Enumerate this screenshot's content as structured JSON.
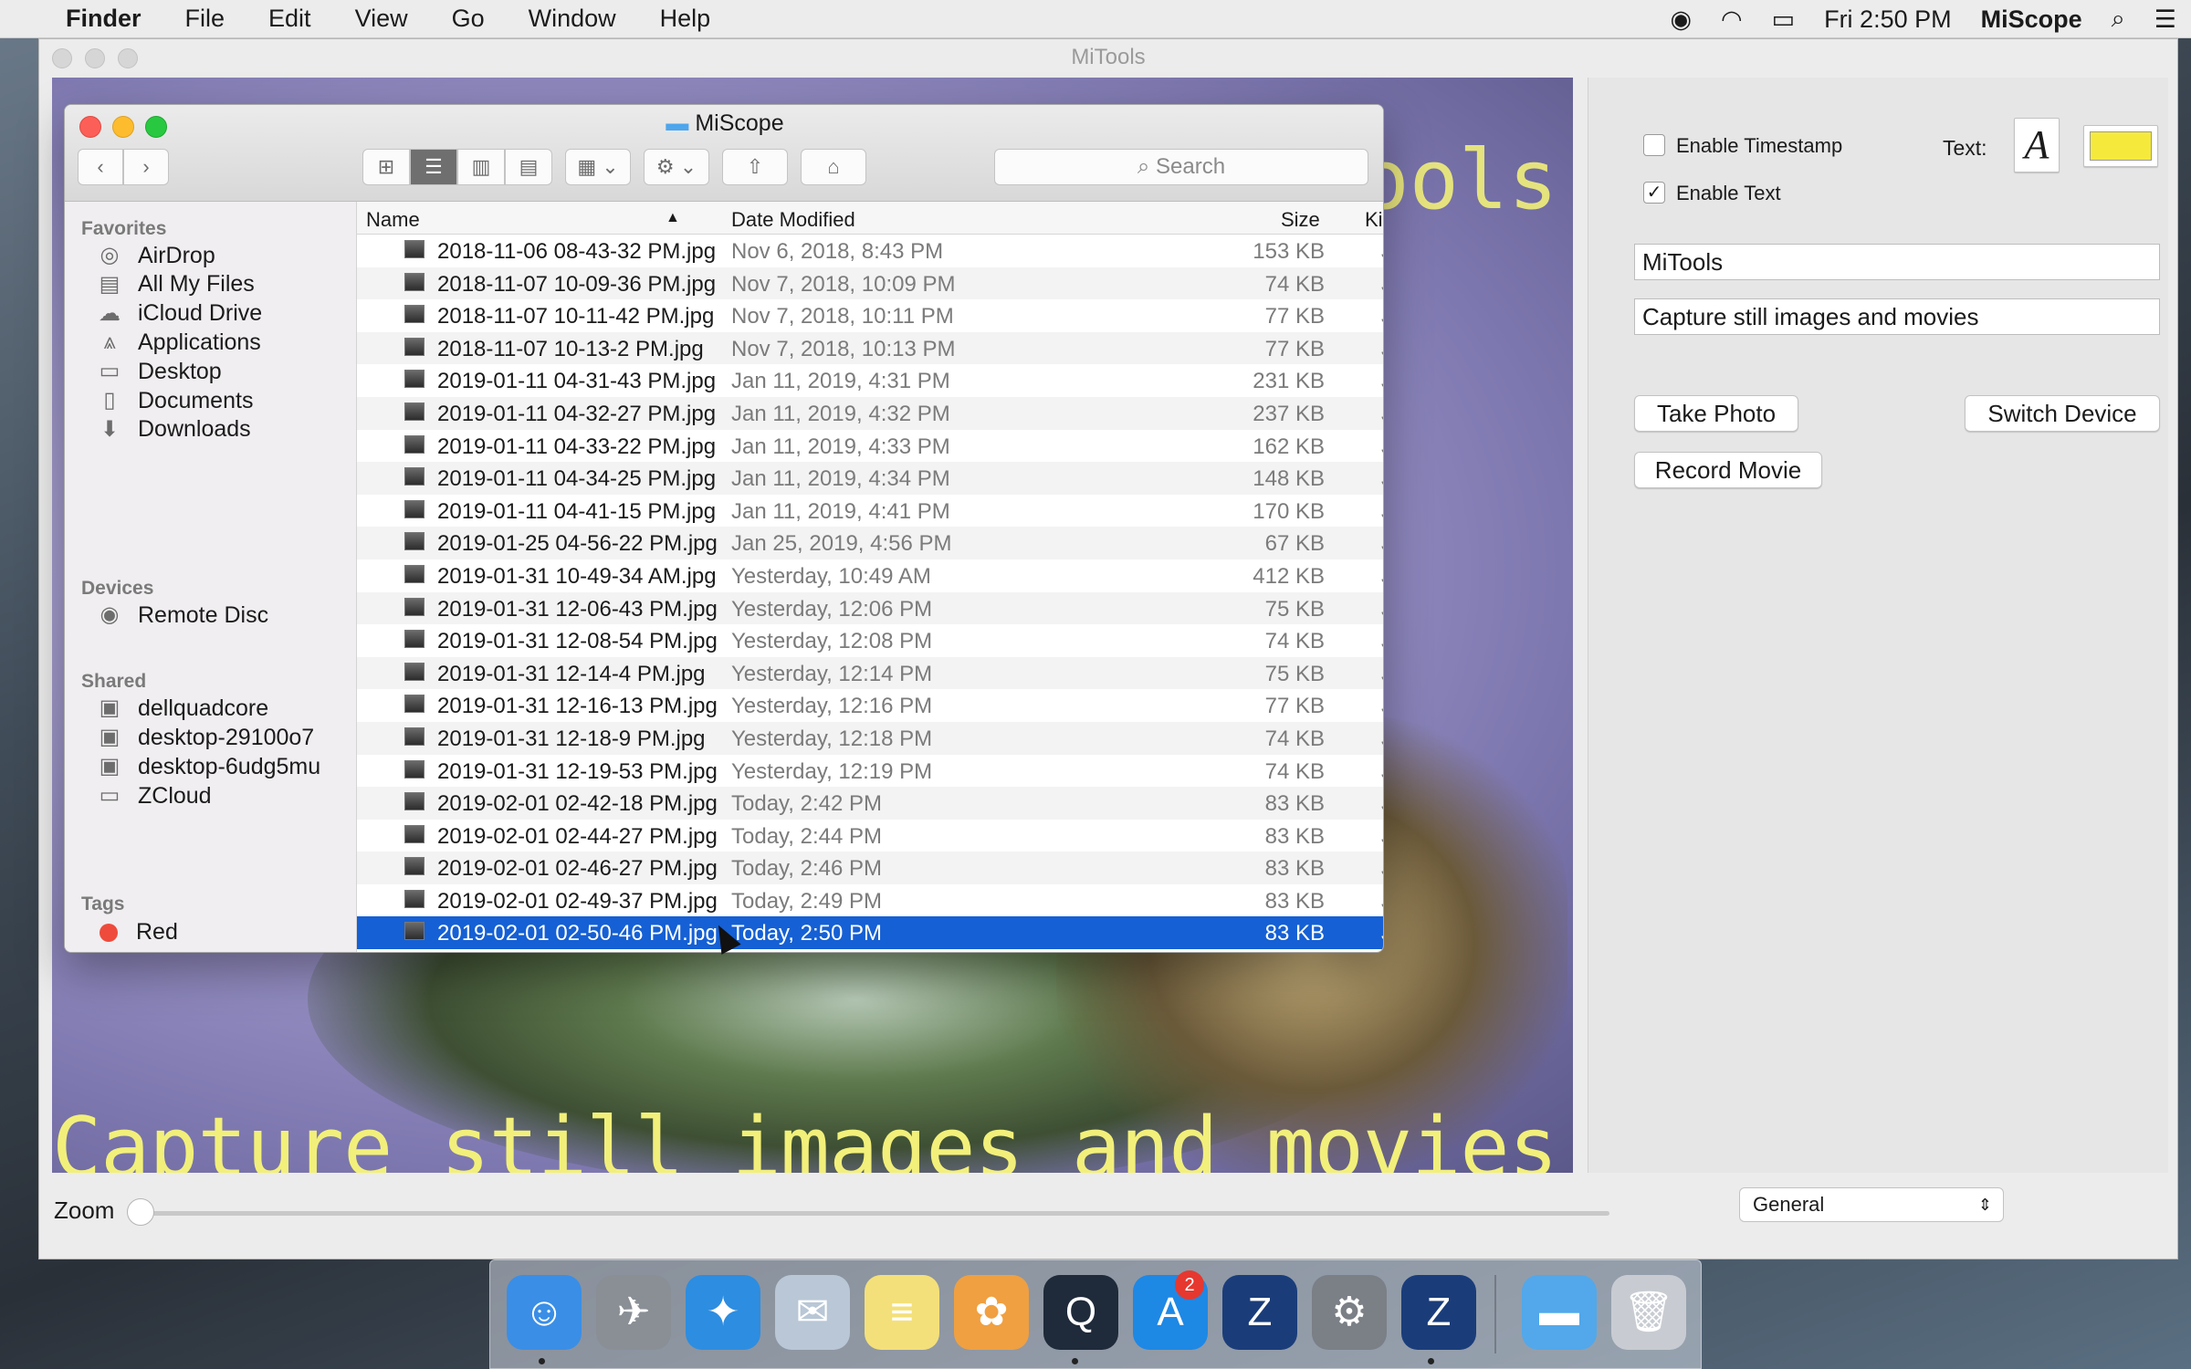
{
  "menubar": {
    "apple": "",
    "app_name": "Finder",
    "items": [
      "File",
      "Edit",
      "View",
      "Go",
      "Window",
      "Help"
    ],
    "clock": "Fri 2:50 PM",
    "right_app": "MiScope"
  },
  "main_window": {
    "title": "MiTools",
    "overlay_top": "MiTools",
    "overlay_bottom": "Capture still images and movies",
    "panel": {
      "enable_timestamp_label": "Enable Timestamp",
      "enable_timestamp_checked": false,
      "enable_text_label": "Enable Text",
      "enable_text_checked": true,
      "check_mark": "✓",
      "text_label": "Text:",
      "font_button_glyph": "A",
      "color_swatch": "#f5ea3c",
      "text_field_1": "MiTools",
      "text_field_2": "Capture still images and movies",
      "take_photo": "Take Photo",
      "switch_device": "Switch Device",
      "record_movie": "Record Movie"
    },
    "zoom_label": "Zoom",
    "zoom_level": 0,
    "general_select": "General"
  },
  "finder": {
    "title": "MiScope",
    "search_placeholder": "Search",
    "sidebar": {
      "favorites_header": "Favorites",
      "favorites": [
        {
          "label": "AirDrop",
          "icon": "airdrop-icon",
          "glyph": "◎"
        },
        {
          "label": "All My Files",
          "icon": "all-files-icon",
          "glyph": "▤"
        },
        {
          "label": "iCloud Drive",
          "icon": "cloud-icon",
          "glyph": "☁"
        },
        {
          "label": "Applications",
          "icon": "applications-icon",
          "glyph": "⩓"
        },
        {
          "label": "Desktop",
          "icon": "desktop-icon",
          "glyph": "▭"
        },
        {
          "label": "Documents",
          "icon": "documents-icon",
          "glyph": "▯"
        },
        {
          "label": "Downloads",
          "icon": "downloads-icon",
          "glyph": "⬇"
        }
      ],
      "devices_header": "Devices",
      "devices": [
        {
          "label": "Remote Disc",
          "icon": "disc-icon",
          "glyph": "◉"
        }
      ],
      "shared_header": "Shared",
      "shared": [
        {
          "label": "dellquadcore",
          "icon": "computer-icon",
          "glyph": "▣"
        },
        {
          "label": "desktop-29100o7",
          "icon": "computer-icon",
          "glyph": "▣"
        },
        {
          "label": "desktop-6udg5mu",
          "icon": "computer-icon",
          "glyph": "▣"
        },
        {
          "label": "ZCloud",
          "icon": "computer-icon",
          "glyph": "▭"
        }
      ],
      "tags_header": "Tags",
      "tags": [
        {
          "label": "Red",
          "color": "#ee4b3c"
        }
      ]
    },
    "columns": {
      "name": "Name",
      "date": "Date Modified",
      "size": "Size",
      "kind": "Ki"
    },
    "files": [
      {
        "name": "2018-11-06 08-43-32 PM.jpg",
        "date": "Nov 6, 2018, 8:43 PM",
        "size": "153 KB",
        "kind": "JF"
      },
      {
        "name": "2018-11-07 10-09-36 PM.jpg",
        "date": "Nov 7, 2018, 10:09 PM",
        "size": "74 KB",
        "kind": "JF"
      },
      {
        "name": "2018-11-07 10-11-42 PM.jpg",
        "date": "Nov 7, 2018, 10:11 PM",
        "size": "77 KB",
        "kind": "JF"
      },
      {
        "name": "2018-11-07 10-13-2 PM.jpg",
        "date": "Nov 7, 2018, 10:13 PM",
        "size": "77 KB",
        "kind": "JF"
      },
      {
        "name": "2019-01-11 04-31-43 PM.jpg",
        "date": "Jan 11, 2019, 4:31 PM",
        "size": "231 KB",
        "kind": "JF"
      },
      {
        "name": "2019-01-11 04-32-27 PM.jpg",
        "date": "Jan 11, 2019, 4:32 PM",
        "size": "237 KB",
        "kind": "JF"
      },
      {
        "name": "2019-01-11 04-33-22 PM.jpg",
        "date": "Jan 11, 2019, 4:33 PM",
        "size": "162 KB",
        "kind": "JF"
      },
      {
        "name": "2019-01-11 04-34-25 PM.jpg",
        "date": "Jan 11, 2019, 4:34 PM",
        "size": "148 KB",
        "kind": "JF"
      },
      {
        "name": "2019-01-11 04-41-15 PM.jpg",
        "date": "Jan 11, 2019, 4:41 PM",
        "size": "170 KB",
        "kind": "JF"
      },
      {
        "name": "2019-01-25 04-56-22 PM.jpg",
        "date": "Jan 25, 2019, 4:56 PM",
        "size": "67 KB",
        "kind": "JF"
      },
      {
        "name": "2019-01-31 10-49-34 AM.jpg",
        "date": "Yesterday, 10:49 AM",
        "size": "412 KB",
        "kind": "JF"
      },
      {
        "name": "2019-01-31 12-06-43 PM.jpg",
        "date": "Yesterday, 12:06 PM",
        "size": "75 KB",
        "kind": "JF"
      },
      {
        "name": "2019-01-31 12-08-54 PM.jpg",
        "date": "Yesterday, 12:08 PM",
        "size": "74 KB",
        "kind": "JF"
      },
      {
        "name": "2019-01-31 12-14-4 PM.jpg",
        "date": "Yesterday, 12:14 PM",
        "size": "75 KB",
        "kind": "JF"
      },
      {
        "name": "2019-01-31 12-16-13 PM.jpg",
        "date": "Yesterday, 12:16 PM",
        "size": "77 KB",
        "kind": "JF"
      },
      {
        "name": "2019-01-31 12-18-9 PM.jpg",
        "date": "Yesterday, 12:18 PM",
        "size": "74 KB",
        "kind": "JF"
      },
      {
        "name": "2019-01-31 12-19-53 PM.jpg",
        "date": "Yesterday, 12:19 PM",
        "size": "74 KB",
        "kind": "JF"
      },
      {
        "name": "2019-02-01 02-42-18 PM.jpg",
        "date": "Today, 2:42 PM",
        "size": "83 KB",
        "kind": "JF"
      },
      {
        "name": "2019-02-01 02-44-27 PM.jpg",
        "date": "Today, 2:44 PM",
        "size": "83 KB",
        "kind": "JF"
      },
      {
        "name": "2019-02-01 02-46-27 PM.jpg",
        "date": "Today, 2:46 PM",
        "size": "83 KB",
        "kind": "JF"
      },
      {
        "name": "2019-02-01 02-49-37 PM.jpg",
        "date": "Today, 2:49 PM",
        "size": "83 KB",
        "kind": "JF"
      },
      {
        "name": "2019-02-01 02-50-46 PM.jpg",
        "date": "Today, 2:50 PM",
        "size": "83 KB",
        "kind": "JF",
        "selected": true
      }
    ]
  },
  "dock": {
    "items": [
      {
        "name": "finder-icon",
        "glyph": "☺",
        "color": "#3a8ee6"
      },
      {
        "name": "launchpad-icon",
        "glyph": "✈",
        "color": "#8a8f96"
      },
      {
        "name": "safari-icon",
        "glyph": "✦",
        "color": "#2d8de0"
      },
      {
        "name": "mail-icon",
        "glyph": "✉",
        "color": "#b9c7d6"
      },
      {
        "name": "notes-icon",
        "glyph": "≡",
        "color": "#f4e07a"
      },
      {
        "name": "photos-icon",
        "glyph": "✿",
        "color": "#f0a040"
      },
      {
        "name": "quicktime-icon",
        "glyph": "Q",
        "color": "#1f2a3a"
      },
      {
        "name": "app-store-icon",
        "glyph": "A",
        "color": "#1e88e5"
      },
      {
        "name": "z-app-icon",
        "glyph": "Z",
        "color": "#1a3d7a"
      },
      {
        "name": "system-preferences-icon",
        "glyph": "⚙",
        "color": "#7b7f86"
      },
      {
        "name": "z-app-2-icon",
        "glyph": "Z",
        "color": "#1a3d7a"
      },
      {
        "name": "folder-icon",
        "glyph": "▬",
        "color": "#52a8ea"
      },
      {
        "name": "trash-icon",
        "glyph": "🗑",
        "color": "#c8ccd2"
      }
    ],
    "app_store_badge": "2"
  }
}
